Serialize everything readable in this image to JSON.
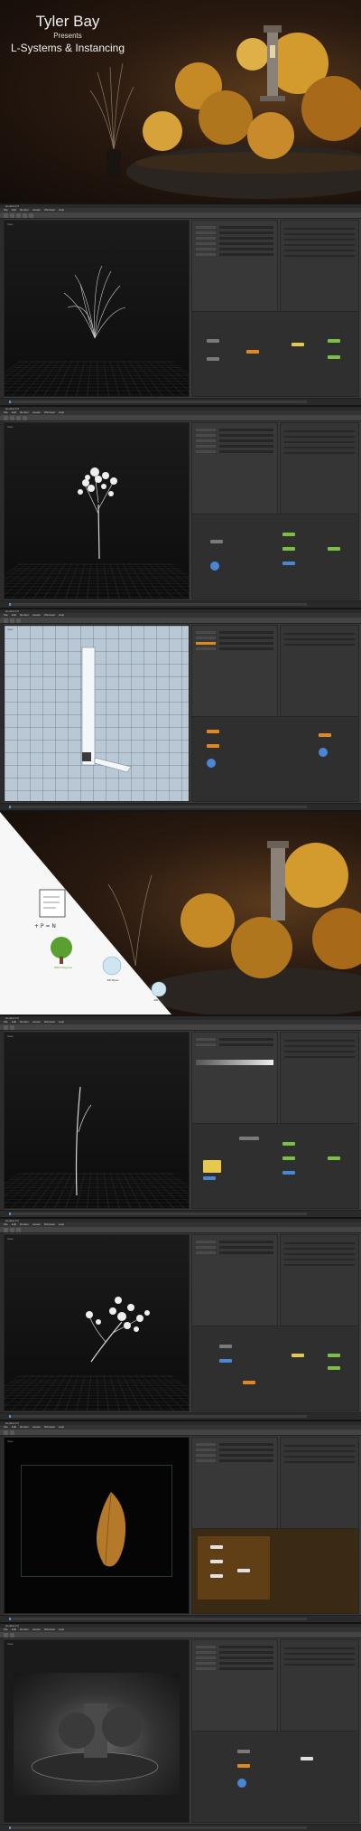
{
  "hero": {
    "author": "Tyler Bay",
    "presents": "Presents",
    "subtitle": "L-Systems & Instancing"
  },
  "screenshots": [
    {
      "title": "Houdini FX",
      "menu": [
        "File",
        "Edit",
        "Render",
        "Assets",
        "Windows",
        "Help"
      ],
      "viewport": "View",
      "content": "grass-tuft"
    },
    {
      "title": "Houdini FX",
      "menu": [
        "File",
        "Edit",
        "Render",
        "Assets",
        "Windows",
        "Help"
      ],
      "viewport": "View",
      "content": "flowering-tree"
    },
    {
      "title": "Houdini FX",
      "menu": [
        "File",
        "Edit",
        "Render",
        "Assets",
        "Windows",
        "Help"
      ],
      "viewport": "View",
      "content": "uv-grid"
    },
    {
      "title": "Houdini FX",
      "menu": [
        "File",
        "Edit",
        "Render",
        "Assets",
        "Windows",
        "Help"
      ],
      "viewport": "View",
      "content": "single-stem"
    },
    {
      "title": "Houdini FX",
      "menu": [
        "File",
        "Edit",
        "Render",
        "Assets",
        "Windows",
        "Help"
      ],
      "viewport": "View",
      "content": "branching-tree"
    },
    {
      "title": "Houdini FX",
      "menu": [
        "File",
        "Edit",
        "Render",
        "Assets",
        "Windows",
        "Help"
      ],
      "viewport": "View",
      "content": "leaf"
    },
    {
      "title": "Houdini FX",
      "menu": [
        "File",
        "Edit",
        "Render",
        "Assets",
        "Windows",
        "Help"
      ],
      "viewport": "View",
      "content": "render"
    }
  ],
  "split": {
    "items": [
      "8000 Polygons",
      "400 Bytes",
      "400 Bytes"
    ]
  },
  "colors": {
    "accent_orange": "#e08a1e",
    "node_green": "#7bc043",
    "node_blue": "#4a86d6",
    "node_yellow": "#e6c84a"
  }
}
